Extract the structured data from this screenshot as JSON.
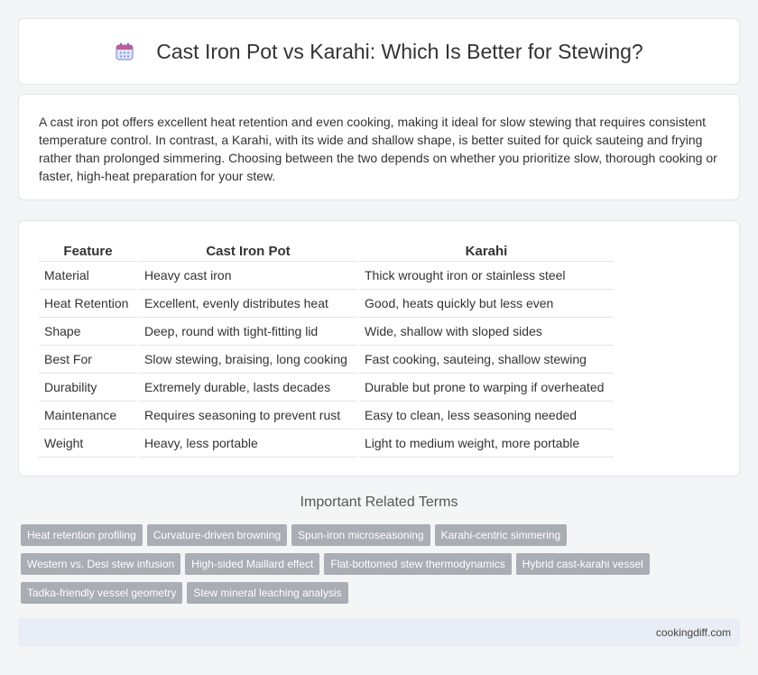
{
  "header": {
    "title": "Cast Iron Pot vs Karahi: Which Is Better for Stewing?",
    "icon": "calendar-icon"
  },
  "intro": "A cast iron pot offers excellent heat retention and even cooking, making it ideal for slow stewing that requires consistent temperature control. In contrast, a Karahi, with its wide and shallow shape, is better suited for quick sauteing and frying rather than prolonged simmering. Choosing between the two depends on whether you prioritize slow, thorough cooking or faster, high-heat preparation for your stew.",
  "table": {
    "headers": [
      "Feature",
      "Cast Iron Pot",
      "Karahi"
    ],
    "rows": [
      [
        "Material",
        "Heavy cast iron",
        "Thick wrought iron or stainless steel"
      ],
      [
        "Heat Retention",
        "Excellent, evenly distributes heat",
        "Good, heats quickly but less even"
      ],
      [
        "Shape",
        "Deep, round with tight-fitting lid",
        "Wide, shallow with sloped sides"
      ],
      [
        "Best For",
        "Slow stewing, braising, long cooking",
        "Fast cooking, sauteing, shallow stewing"
      ],
      [
        "Durability",
        "Extremely durable, lasts decades",
        "Durable but prone to warping if overheated"
      ],
      [
        "Maintenance",
        "Requires seasoning to prevent rust",
        "Easy to clean, less seasoning needed"
      ],
      [
        "Weight",
        "Heavy, less portable",
        "Light to medium weight, more portable"
      ]
    ]
  },
  "related": {
    "title": "Important Related Terms",
    "tags": [
      "Heat retention profiling",
      "Curvature-driven browning",
      "Spun-iron microseasoning",
      "Karahi-centric simmering",
      "Western vs. Desi stew infusion",
      "High-sided Maillard effect",
      "Flat-bottomed stew thermodynamics",
      "Hybrid cast-karahi vessel",
      "Tadka-friendly vessel geometry",
      "Stew mineral leaching analysis"
    ]
  },
  "footer": {
    "site": "cookingdiff.com"
  }
}
